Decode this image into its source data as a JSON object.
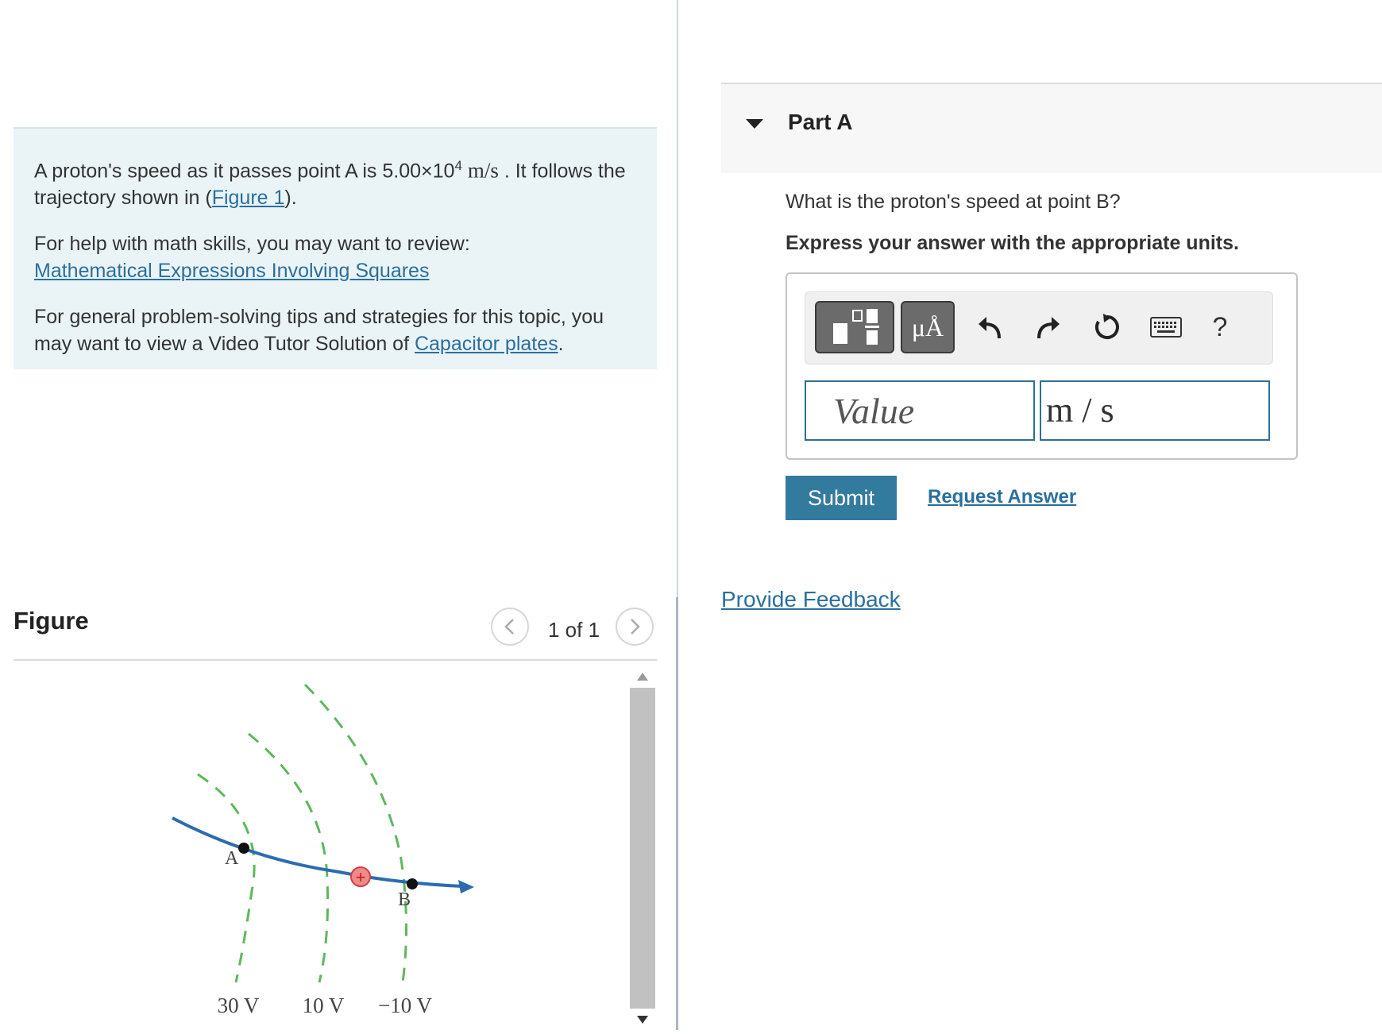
{
  "problem": {
    "speed_intro": "A proton's speed as it passes point A is 5.00×10",
    "speed_exp": "4",
    "speed_unit": "m/s",
    "speed_outro": ". It follows the trajectory shown in (",
    "figure_link": "Figure 1",
    "figure_close": ").",
    "math_help_text": "For help with math skills, you may want to review:",
    "math_help_link": "Mathematical Expressions Involving Squares",
    "tips_text": "For general problem-solving tips and strategies for this topic, you may want to view a Video Tutor Solution of ",
    "tips_link": "Capacitor plates",
    "tips_end": "."
  },
  "figure": {
    "title": "Figure",
    "pager": "1 of 1",
    "point_a": "A",
    "point_b": "B",
    "charge_symbol": "+",
    "potentials": [
      "30 V",
      "10 V",
      "−10 V"
    ]
  },
  "part": {
    "title": "Part A",
    "question": "What is the proton's speed at point B?",
    "instruction": "Express your answer with the appropriate units."
  },
  "answer": {
    "units_tool": "μÅ",
    "help": "?",
    "value_placeholder": "Value",
    "units_value": "m / s"
  },
  "actions": {
    "submit": "Submit",
    "request_answer": "Request Answer",
    "feedback": "Provide Feedback"
  },
  "colors": {
    "accent": "#337a9f",
    "link": "#2a6f9e",
    "trajectory": "#2d6bb0",
    "equipotential": "#5cb85c",
    "charge": "#e05050"
  }
}
